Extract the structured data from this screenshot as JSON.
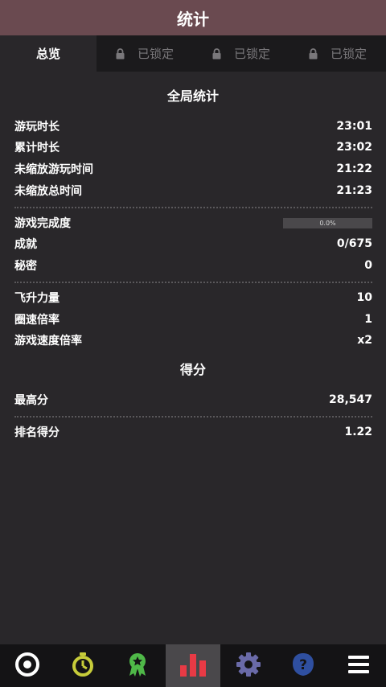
{
  "header": {
    "title": "统计"
  },
  "tabs": [
    {
      "label": "总览",
      "active": true
    },
    {
      "label": "已锁定",
      "locked": true
    },
    {
      "label": "已锁定",
      "locked": true
    },
    {
      "label": "已锁定",
      "locked": true
    }
  ],
  "global": {
    "title": "全局统计",
    "play_time": {
      "label": "游玩时长",
      "value": "23:01"
    },
    "total_time": {
      "label": "累计时长",
      "value": "23:02"
    },
    "unscaled_play": {
      "label": "未缩放游玩时间",
      "value": "21:22"
    },
    "unscaled_total": {
      "label": "未缩放总时间",
      "value": "21:23"
    },
    "completion": {
      "label": "游戏完成度",
      "value": "0.0%",
      "fraction": 0.0
    },
    "achievements": {
      "label": "成就",
      "value": "0/675"
    },
    "secrets": {
      "label": "秘密",
      "value": "0"
    },
    "ascension": {
      "label": "飞升力量",
      "value": "10"
    },
    "lap_speed": {
      "label": "圈速倍率",
      "value": "1"
    },
    "game_speed": {
      "label": "游戏速度倍率",
      "value": "x2"
    }
  },
  "score": {
    "title": "得分",
    "high": {
      "label": "最高分",
      "value": "28,547"
    },
    "rank": {
      "label": "排名得分",
      "value": "1.22"
    }
  },
  "bottom_nav": [
    {
      "icon": "target-icon",
      "active": false
    },
    {
      "icon": "stopwatch-icon",
      "active": false
    },
    {
      "icon": "award-ribbon-icon",
      "active": false
    },
    {
      "icon": "bar-chart-icon",
      "active": true
    },
    {
      "icon": "gear-icon",
      "active": false
    },
    {
      "icon": "help-icon",
      "active": false
    },
    {
      "icon": "menu-icon",
      "active": false
    }
  ],
  "colors": {
    "header_bg": "#6a4a50",
    "background": "#29272a",
    "tabbar_bg": "#1b1a1c",
    "navbar_bg": "#141315"
  }
}
